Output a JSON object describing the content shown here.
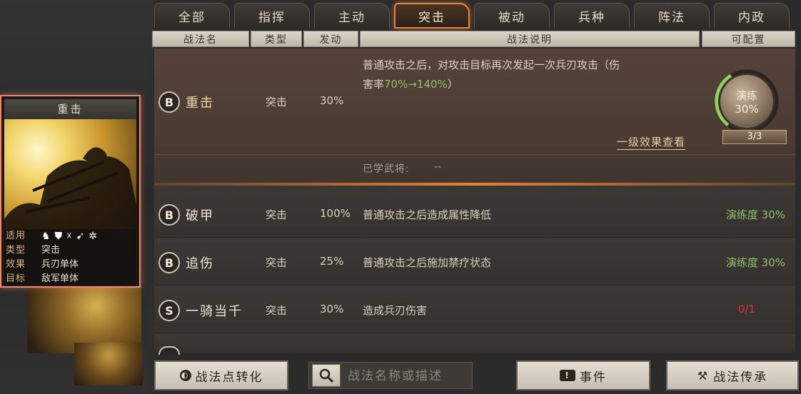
{
  "tabs": [
    "全部",
    "指挥",
    "主动",
    "突击",
    "被动",
    "兵种",
    "阵法",
    "内政"
  ],
  "active_tab": "突击",
  "headers": {
    "name": "战法名",
    "type": "类型",
    "rate": "发动",
    "desc": "战法说明",
    "config": "可配置"
  },
  "expanded": {
    "grade": "B",
    "name": "重击",
    "type": "突击",
    "rate": "30%",
    "desc_line1": "普通攻击之后，对攻击目标再次发起一次兵刃攻击（伤",
    "desc_line2_prefix": "害率",
    "desc_line2_highlight": "70%→140%",
    "desc_line2_suffix": "）",
    "level_link": "一级效果查看",
    "learned_label": "已学武将:",
    "learned_value": "--",
    "train_label": "演练",
    "train_value": "30%",
    "train_count": "3/3"
  },
  "rows": [
    {
      "grade": "B",
      "name": "破甲",
      "type": "突击",
      "rate": "100%",
      "desc": "普通攻击之后造成属性降低",
      "config": "演练度 30%"
    },
    {
      "grade": "B",
      "name": "追伤",
      "type": "突击",
      "rate": "25%",
      "desc": "普通攻击之后施加禁疗状态",
      "config": "演练度 30%"
    },
    {
      "grade": "S",
      "name": "一骑当千",
      "type": "突击",
      "rate": "30%",
      "desc": "造成兵刃伤害",
      "config": "0/1"
    }
  ],
  "card": {
    "title": "重击",
    "info": [
      {
        "k": "适用",
        "v": ""
      },
      {
        "k": "类型",
        "v": "突击"
      },
      {
        "k": "效果",
        "v": "兵刃单体"
      },
      {
        "k": "目标",
        "v": "敌军单体"
      }
    ],
    "unit_icons": [
      "cavalry-icon",
      "shield-icon",
      "bow-icon",
      "spear-icon",
      "chariot-icon"
    ]
  },
  "buttons": {
    "convert": "战法点转化",
    "search_placeholder": "战法名称或描述",
    "event": "事件",
    "inherit": "战法传承"
  },
  "colors": {
    "accent": "#e8833a",
    "highlight_green": "#8fc06a",
    "warn_red": "#e0302a"
  }
}
